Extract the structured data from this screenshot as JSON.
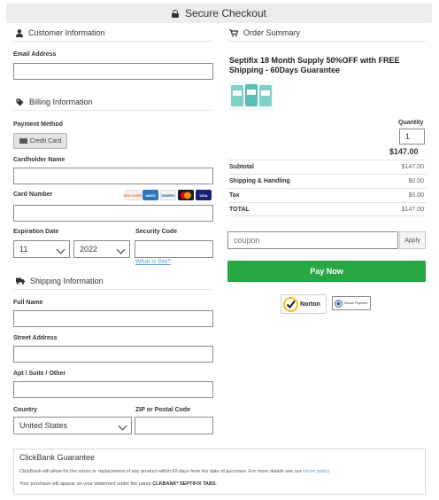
{
  "header": {
    "title": "Secure Checkout"
  },
  "customer": {
    "heading": "Customer Information",
    "email_label": "Email Address",
    "email_value": ""
  },
  "billing": {
    "heading": "Billing Information",
    "payment_method_label": "Payment Method",
    "payment_method_button": "Credit Card",
    "cardholder_label": "Cardholder Name",
    "cardholder_value": "",
    "card_number_label": "Card Number",
    "card_number_value": "",
    "card_brands": [
      "DISCOVER",
      "AMEX",
      "DINERS",
      "MC",
      "VISA"
    ],
    "expiration_label": "Expiration Date",
    "exp_month": "11",
    "exp_year": "2022",
    "security_code_label": "Security Code",
    "security_code_value": "",
    "what_is_this": "What is this?"
  },
  "shipping": {
    "heading": "Shipping Information",
    "full_name_label": "Full Name",
    "street_label": "Street Address",
    "apt_label": "Apt / Suite / Other",
    "country_label": "Country",
    "country_value": "United States",
    "zip_label": "ZIP or Postal Code"
  },
  "order": {
    "heading": "Order Summary",
    "product_title": "Septifix 18 Month Supply 50%OFF with FREE Shipping - 60Days Guarantee",
    "quantity_label": "Quantity",
    "quantity_value": "1",
    "line_price": "$147.00",
    "rows": [
      {
        "label": "Subtotal",
        "value": "$147.00"
      },
      {
        "label": "Shipping & Handling",
        "value": "$0.00"
      },
      {
        "label": "Tax",
        "value": "$0.00"
      },
      {
        "label": "TOTAL",
        "value": "$147.00"
      }
    ],
    "coupon_placeholder": "coupon",
    "apply_label": "Apply",
    "pay_label": "Pay Now",
    "norton_label": "Norton",
    "secure_payment_label": "Secure Payment"
  },
  "guarantee": {
    "title": "ClickBank Guarantee",
    "line1_a": "ClickBank will allow for the return or replacement of any product within 60 days from the date of purchase. For more details see our ",
    "line1_link": "return policy",
    "line1_b": ".",
    "line2_a": "Your purchase will appear on your statement under the name ",
    "line2_b": "CLKBANK* SEPTIFIX TABS",
    "line2_c": "."
  },
  "colors": {
    "pay_button": "#28a745",
    "link": "#5a9ec9",
    "header_bg": "#ececec"
  }
}
